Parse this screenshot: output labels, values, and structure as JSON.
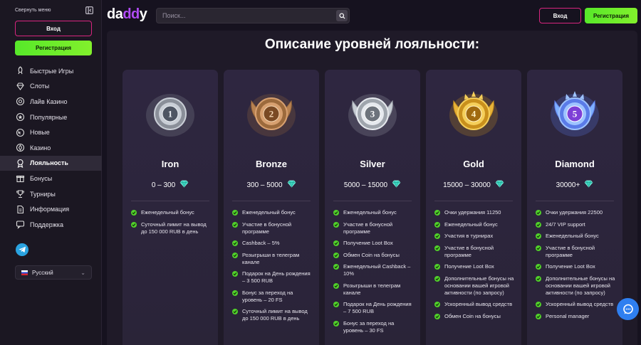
{
  "sidebar": {
    "collapse_label": "Свернуть меню",
    "login_label": "Вход",
    "register_label": "Регистрация",
    "items": [
      {
        "label": "Быстрые Игры",
        "icon": "rocket-icon"
      },
      {
        "label": "Слоты",
        "icon": "diamond-icon"
      },
      {
        "label": "Лайв Казино",
        "icon": "chip-icon"
      },
      {
        "label": "Популярные",
        "icon": "star-icon"
      },
      {
        "label": "Новые",
        "icon": "new-badge-icon"
      },
      {
        "label": "Казино",
        "icon": "poker-chip-icon"
      },
      {
        "label": "Лояльность",
        "icon": "loyalty-icon",
        "active": true
      },
      {
        "label": "Бонусы",
        "icon": "gift-icon"
      },
      {
        "label": "Турниры",
        "icon": "trophy-icon"
      },
      {
        "label": "Информация",
        "icon": "document-icon"
      },
      {
        "label": "Поддержка",
        "icon": "chat-icon"
      }
    ],
    "language": "Русский"
  },
  "header": {
    "logo_text_a": "da",
    "logo_text_b": "dd",
    "logo_text_c": "y",
    "search_placeholder": "Поиск...",
    "login_label": "Вход",
    "register_label": "Регистрация"
  },
  "main": {
    "title": "Описание уровней лояльности:",
    "levels": [
      {
        "name": "Iron",
        "range": "0 – 300",
        "medal_number": "1",
        "features": [
          "Еженедельный бонус",
          "Суточный лимит на вывод до 150 000 RUB в день"
        ]
      },
      {
        "name": "Bronze",
        "range": "300 – 5000",
        "medal_number": "2",
        "features": [
          "Еженедельный бонус",
          "Участие в бонусной программе",
          "Cashback – 5%",
          "Розыгрыши в телеграм канале",
          "Подарок на День рождения – 3 500 RUB",
          "Бонус за переход на уровень – 20 FS",
          "Суточный лимит на вывод до 150 000 RUB в день"
        ]
      },
      {
        "name": "Silver",
        "range": "5000 – 15000",
        "medal_number": "3",
        "features": [
          "Еженедельный бонус",
          "Участие в бонусной программе",
          "Получение Loot Box",
          "Обмен Coin на бонусы",
          "Еженедельный Cashback – 10%",
          "Розыгрыши в телеграм канале",
          "Подарок на День рождения – 7 500 RUB",
          "Бонус за переход на уровень – 30 FS"
        ]
      },
      {
        "name": "Gold",
        "range": "15000 – 30000",
        "medal_number": "4",
        "features": [
          "Очки удержания 11250",
          "Еженедельный бонус",
          "Участия в турнирах",
          "Участие в бонусной программе",
          "Получение Loot Box",
          "Дополнительные бонусы на основании вашей игровой активности (по запросу)",
          "Ускоренный вывод средств",
          "Обмен Coin на бонусы"
        ]
      },
      {
        "name": "Diamond",
        "range": "30000+",
        "medal_number": "5",
        "features": [
          "Очки удержания 22500",
          "24/7 VIP support",
          "Еженедельный бонус",
          "Участие в бонусной программе",
          "Получение Loot Box",
          "Дополнительные бонусы на основании вашей игровой активности (по запросу)",
          "Ускоренный вывод средств",
          "Personal manager"
        ]
      }
    ]
  },
  "colors": {
    "accent_pink": "#d8257f",
    "accent_green": "#57e82a",
    "logo_purple": "#b14bf4",
    "check_green": "#51d12a",
    "gem_teal": "#3fd9c4",
    "chat_blue": "#2f7ff0"
  }
}
